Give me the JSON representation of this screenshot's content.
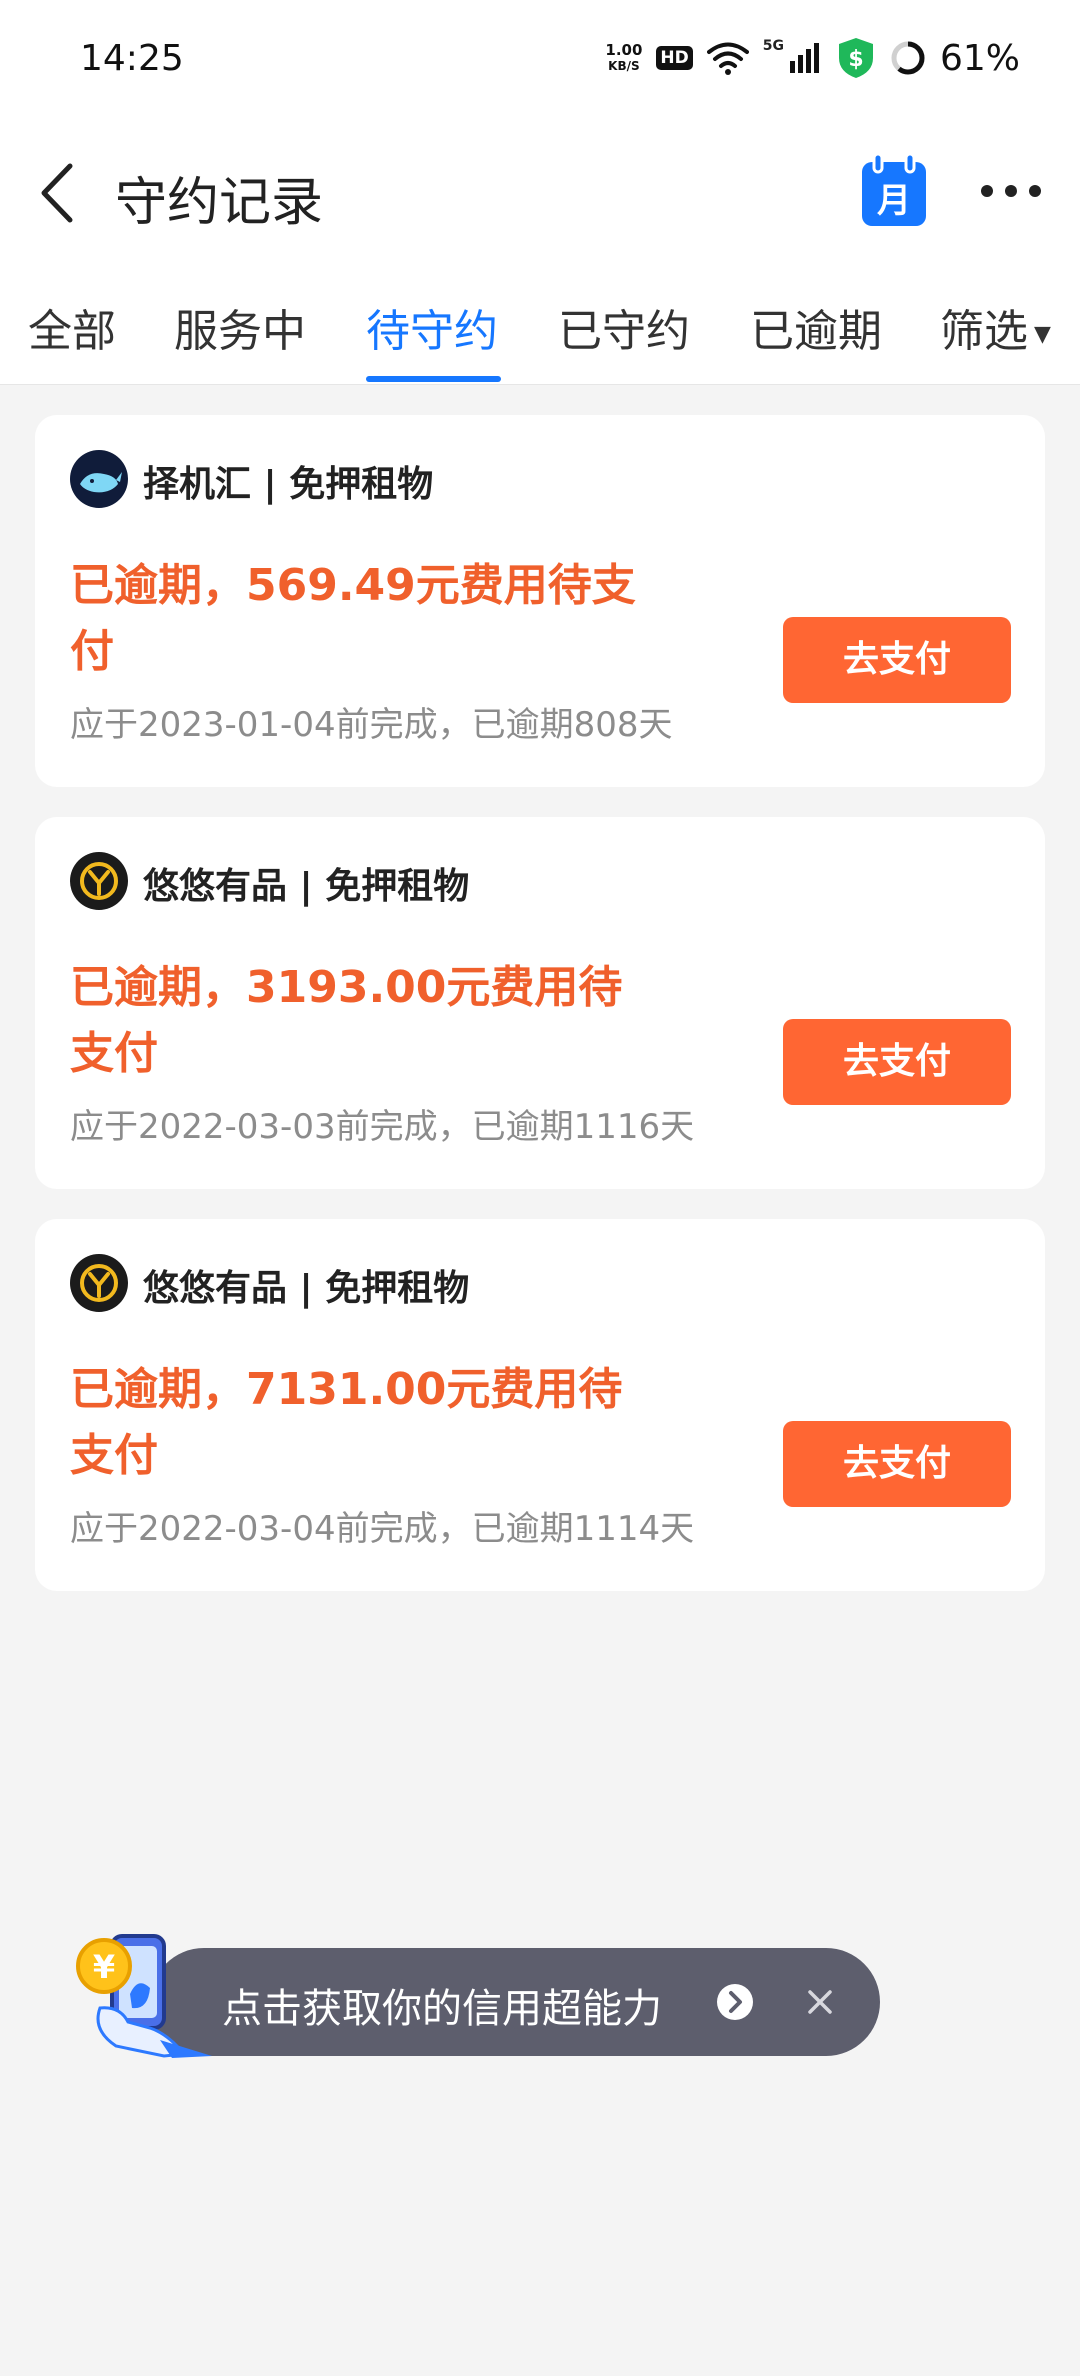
{
  "status_bar": {
    "time": "14:25",
    "net_speed_value": "1.00",
    "net_speed_unit": "KB/S",
    "hd_label": "HD",
    "network_label": "5G",
    "battery_percent": "61%",
    "battery_level": 0.61
  },
  "header": {
    "title": "守约记录",
    "calendar_icon_label": "月",
    "accent_color": "#1677ff"
  },
  "tabs": {
    "items": [
      {
        "label": "全部"
      },
      {
        "label": "服务中"
      },
      {
        "label": "待守约"
      },
      {
        "label": "已守约"
      },
      {
        "label": "已逾期"
      },
      {
        "label": "筛选"
      }
    ],
    "active_index": 2
  },
  "records": [
    {
      "merchant": "择机汇 | 免押租物",
      "logo_icon": "whale-logo-icon",
      "status_text": "已逾期，569.49元费用待支付",
      "deadline_text": "应于2023-01-04前完成，已逾期808天",
      "button_label": "去支付"
    },
    {
      "merchant": "悠悠有品 | 免押租物",
      "logo_icon": "yoyo-logo-icon",
      "status_text": "已逾期，3193.00元费用待支付",
      "deadline_text": "应于2022-03-03前完成，已逾期1116天",
      "button_label": "去支付"
    },
    {
      "merchant": "悠悠有品 | 免押租物",
      "logo_icon": "yoyo-logo-icon",
      "status_text": "已逾期，7131.00元费用待支付",
      "deadline_text": "应于2022-03-04前完成，已逾期1114天",
      "button_label": "去支付"
    }
  ],
  "promo": {
    "text": "点击获取你的信用超能力",
    "coin_symbol": "¥"
  },
  "colors": {
    "overdue_text": "#f0602c",
    "pay_button": "#ff6633",
    "promo_bg": "#5d5e6d"
  }
}
